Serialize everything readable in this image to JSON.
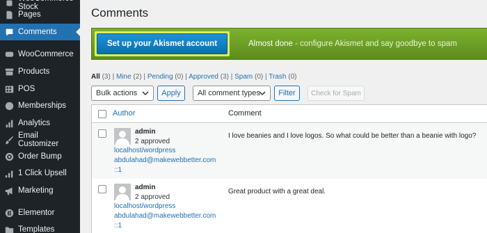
{
  "sidebar": {
    "items": [
      {
        "label": "WooCommerce Stock",
        "icon": "plugin-icon"
      },
      {
        "label": "Pages",
        "icon": "page-icon"
      },
      {
        "label": "Comments",
        "icon": "comment-icon",
        "active": true
      },
      {
        "label": "WooCommerce",
        "icon": "woo-icon"
      },
      {
        "label": "Products",
        "icon": "archive-icon"
      },
      {
        "label": "POS",
        "icon": "pos-icon"
      },
      {
        "label": "Memberships",
        "icon": "membership-icon"
      },
      {
        "label": "Analytics",
        "icon": "chart-icon"
      },
      {
        "label": "Email Customizer",
        "icon": "brush-icon"
      },
      {
        "label": "Order Bump",
        "icon": "target-icon"
      },
      {
        "label": "1 Click Upsell",
        "icon": "chart-bar-icon"
      },
      {
        "label": "Marketing",
        "icon": "megaphone-icon"
      },
      {
        "label": "Elementor",
        "icon": "elementor-icon"
      },
      {
        "label": "Templates",
        "icon": "folder-icon"
      }
    ]
  },
  "page": {
    "title": "Comments"
  },
  "akismet": {
    "button_label": "Set up your Akismet account",
    "message_bold": "Almost done",
    "message_rest": " - configure Akismet and say goodbye to spam"
  },
  "filters": {
    "all": "All",
    "all_count": "(3)",
    "mine": "Mine",
    "mine_count": "(2)",
    "pending": "Pending",
    "pending_count": "(0)",
    "approved": "Approved",
    "approved_count": "(3)",
    "spam": "Spam",
    "spam_count": "(0)",
    "trash": "Trash",
    "trash_count": "(0)",
    "sep": " | "
  },
  "toolbar": {
    "bulk_actions": "Bulk actions",
    "apply": "Apply",
    "comment_types": "All comment types",
    "filter": "Filter",
    "check_spam": "Check for Spam"
  },
  "table": {
    "col_author": "Author",
    "col_comment": "Comment",
    "rows": [
      {
        "name": "admin",
        "approved": "2 approved",
        "url": "localhost/wordpress",
        "email": "abdulahad@makewebbetter.com",
        "ip": "::1",
        "comment": "I love beanies and I love logos. So what could be better than a beanie with logo?"
      },
      {
        "name": "admin",
        "approved": "2 approved",
        "url": "localhost/wordpress",
        "email": "abdulahad@makewebbetter.com",
        "ip": "::1",
        "comment": "Great product with a great deal."
      }
    ]
  },
  "colors": {
    "accent": "#2271b1",
    "sidebar": "#1d2327",
    "akismet_green": "#67a025"
  }
}
